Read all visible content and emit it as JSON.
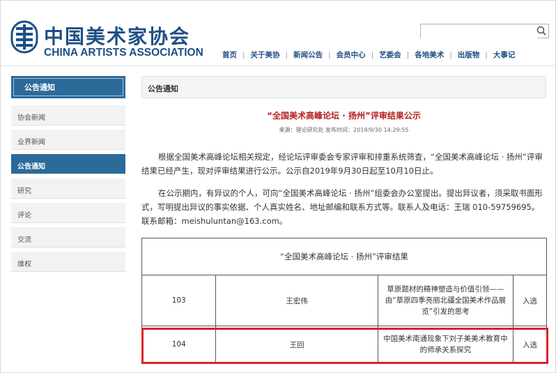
{
  "header": {
    "logo_cn": "中国美术家协会",
    "logo_en": "CHINA ARTISTS ASSOCIATION",
    "search": {
      "value": "",
      "placeholder": ""
    }
  },
  "nav": {
    "items": [
      "首页",
      "关于美协",
      "新闻公告",
      "会员中心",
      "艺委会",
      "各地美术",
      "出版物",
      "大事记"
    ]
  },
  "sidebar": {
    "header": "公告通知",
    "items": [
      {
        "label": "协会新闻",
        "active": false
      },
      {
        "label": "业界新闻",
        "active": false
      },
      {
        "label": "公告通知",
        "active": true
      },
      {
        "label": "研究",
        "active": false
      },
      {
        "label": "评论",
        "active": false
      },
      {
        "label": "交流",
        "active": false
      },
      {
        "label": "维权",
        "active": false
      }
    ]
  },
  "main": {
    "section_title": "公告通知",
    "article": {
      "title": "“全国美术高峰论坛 · 扬州”评审结果公示",
      "meta": "来源：理论研究处 发布时间：2019/9/30 14:29:55",
      "para1": "根据全国美术高峰论坛相关规定，经论坛评审委会专家评审和排重系统筛查，“全国美术高峰论坛 · 扬州”评审结果已经产生，现对评审结果进行公示。公示自2019年9月30日起至10月10日止。",
      "para2": "在公示期内，有异议的个人，可向“全国美术高峰论坛 · 扬州”组委会办公室提出。提出异议者，须采取书面形式，写明提出异议的事实依据、个人真实姓名、地址邮编和联系方式等。联系人及电话：王瑞 010-59759695。联系邮箱：meishuluntan@163.com。"
    },
    "table": {
      "caption": "“全国美术高峰论坛 · 扬州”评审结果",
      "rows": [
        {
          "num": "103",
          "name": "王宏伟",
          "title": "草原题材的精神塑造与价值引领——由“草原四季亮丽北疆全国美术作品展览”引发的思考",
          "result": "入选"
        },
        {
          "num": "104",
          "name": "王回",
          "title": "中国美术南通现象下刘子美美术教育中的师承关系探究",
          "result": "入选"
        }
      ]
    }
  },
  "colors": {
    "brand_blue": "#1d4f86",
    "sidebar_blue": "#2c6a9a",
    "title_red": "#b41f1f",
    "highlight_red": "#d9242c"
  }
}
